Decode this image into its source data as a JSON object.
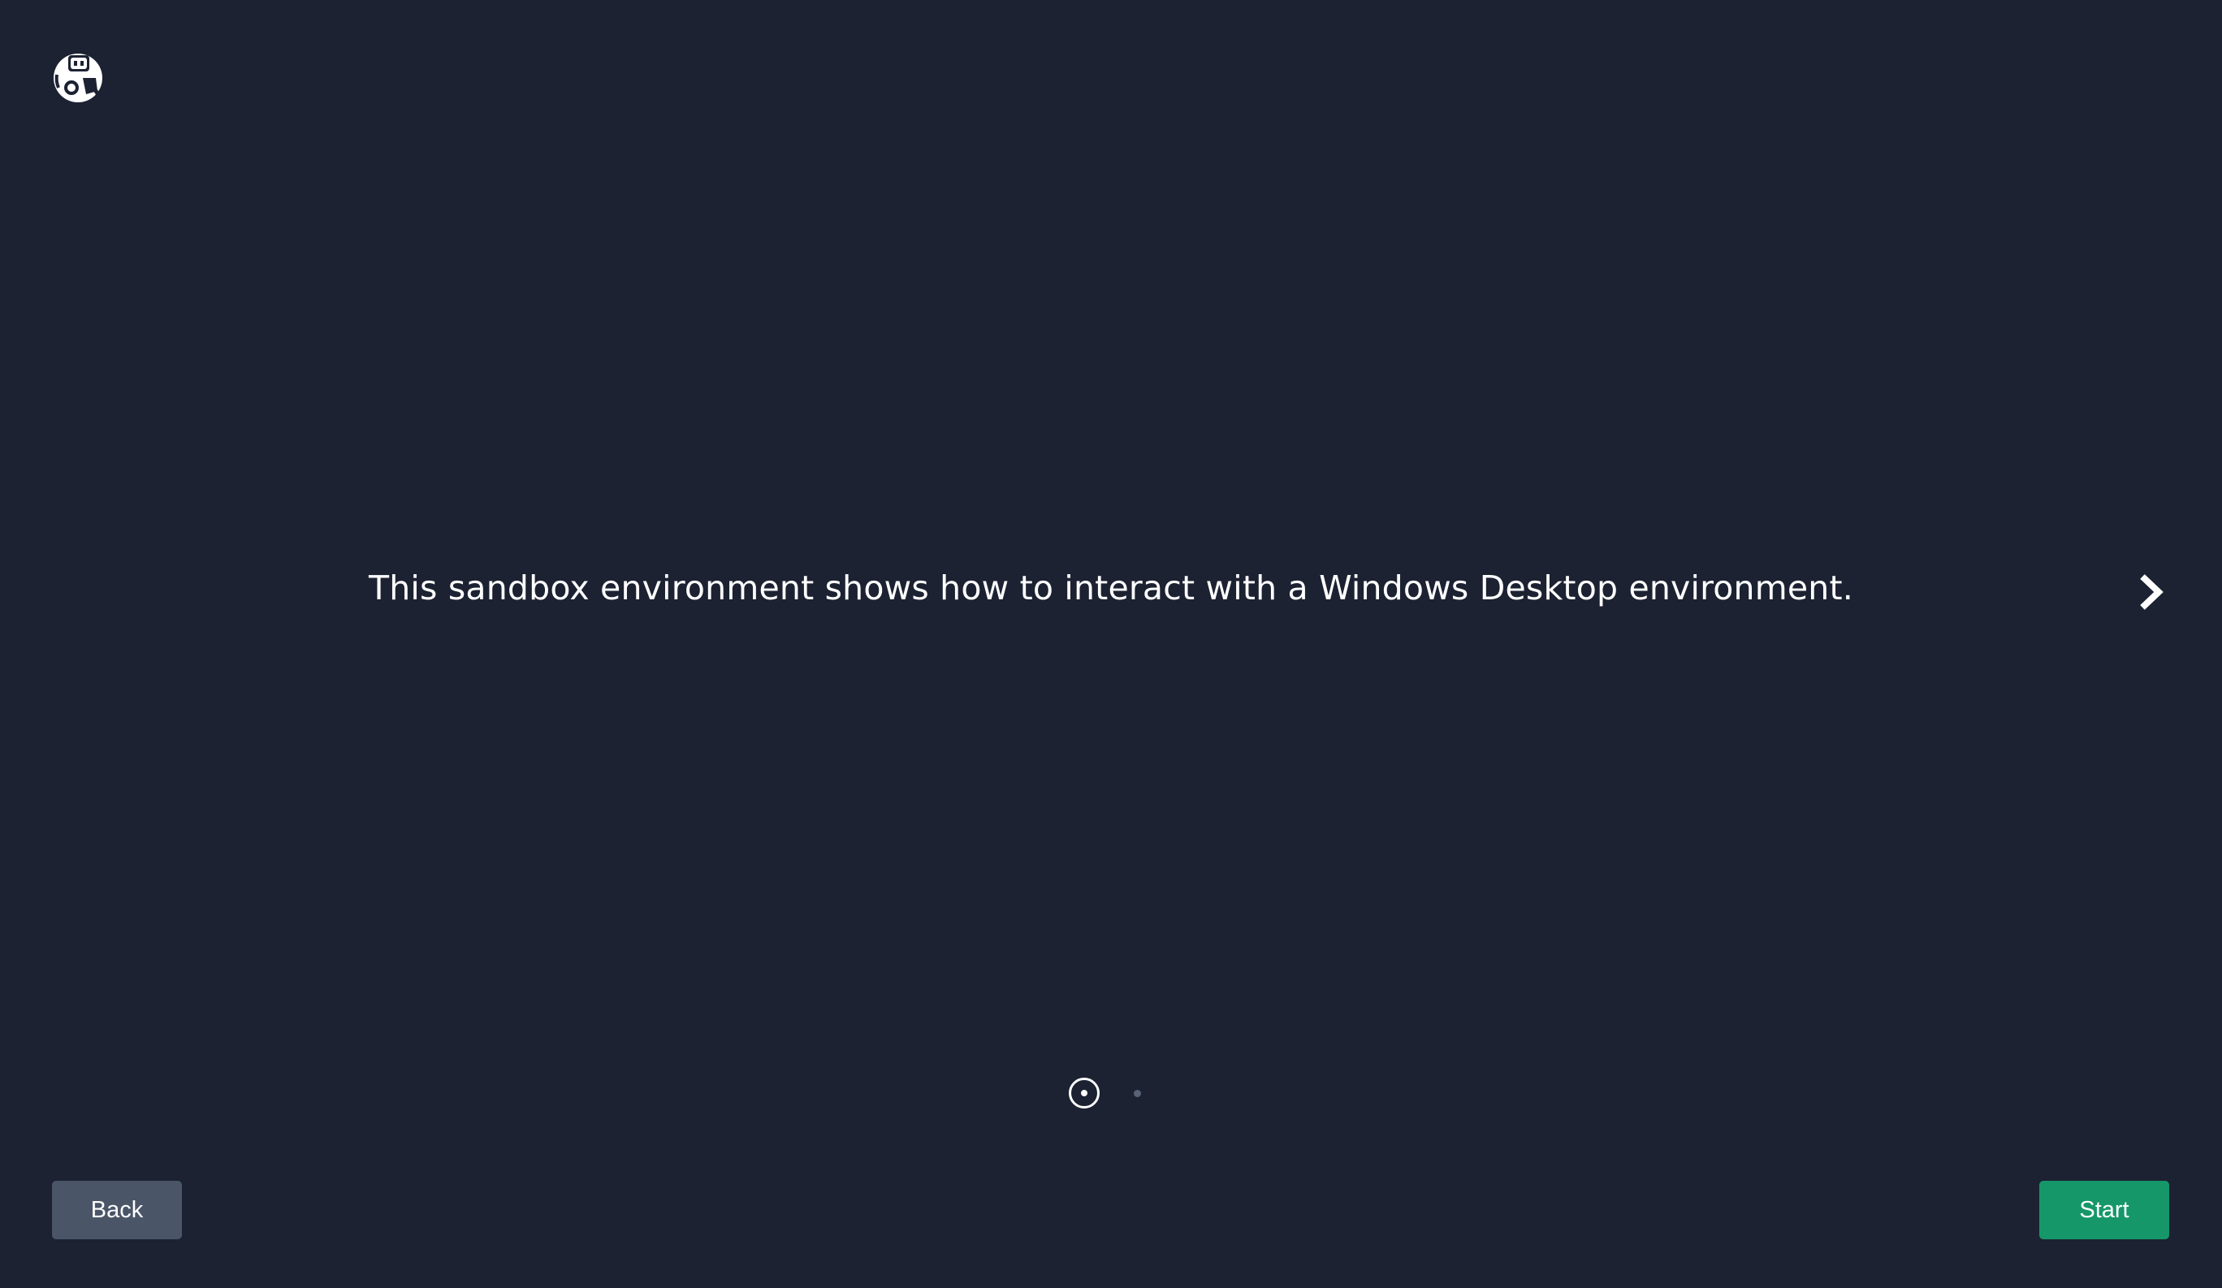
{
  "slide": {
    "text": "This sandbox environment shows how to interact with a Windows Desktop environment.",
    "current_index": 1,
    "total": 2
  },
  "navigation": {
    "back_label": "Back",
    "start_label": "Start"
  },
  "icons": {
    "logo": "robot-logo-icon",
    "next": "chevron-right-icon"
  },
  "colors": {
    "background": "#1c2232",
    "back_button": "#4b5568",
    "start_button": "#15976a",
    "text": "#ffffff"
  }
}
